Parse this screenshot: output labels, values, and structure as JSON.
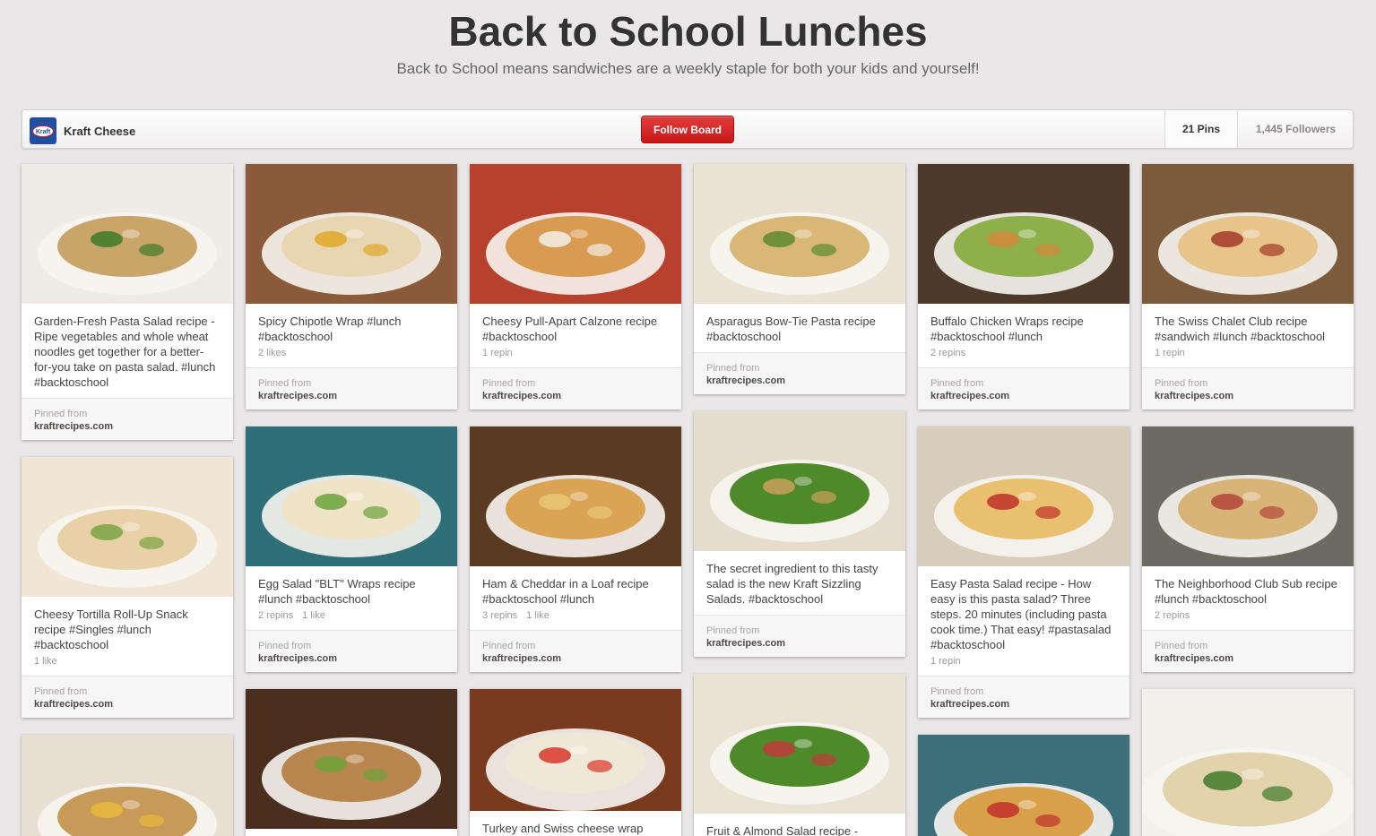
{
  "board": {
    "title": "Back to School Lunches",
    "description": "Back to School means sandwiches are a weekly staple for both your kids and yourself!",
    "owner": "Kraft Cheese",
    "owner_logo_text": "Kraft",
    "follow_label": "Follow Board",
    "pins_count": "21 Pins",
    "followers_count": "1,445 Followers"
  },
  "source_label": "Pinned from",
  "pins": [
    {
      "desc": "Garden-Fresh Pasta Salad recipe - Ripe vegetables and whole wheat noodles get together for a better-for-you take on pasta salad. #lunch #backtoschool",
      "stat1": "",
      "stat2": "",
      "source": "kraftrecipes.com",
      "img_base": "#efece5",
      "img_food": "#c9a56a",
      "img_accent": "#3e7a2a"
    },
    {
      "desc": "Spicy Chipotle Wrap #lunch #backtoschool",
      "stat1": "2 likes",
      "stat2": "",
      "source": "kraftrecipes.com",
      "img_base": "#8a5a3a",
      "img_food": "#e8d6b2",
      "img_accent": "#e0a827"
    },
    {
      "desc": "Cheesy Pull-Apart Calzone recipe #backtoschool",
      "stat1": "1 repin",
      "stat2": "",
      "source": "kraftrecipes.com",
      "img_base": "#b8412e",
      "img_food": "#d99a52",
      "img_accent": "#f3efe6"
    },
    {
      "desc": "Asparagus Bow-Tie Pasta recipe #backtoschool",
      "stat1": "",
      "stat2": "",
      "source": "kraftrecipes.com",
      "img_base": "#e9e3d6",
      "img_food": "#d8b777",
      "img_accent": "#5c8a2c"
    },
    {
      "desc": "Buffalo Chicken Wraps recipe #backtoschool #lunch",
      "stat1": "2 repins",
      "stat2": "",
      "source": "kraftrecipes.com",
      "img_base": "#4d3a2a",
      "img_food": "#8db04a",
      "img_accent": "#d58a3a"
    },
    {
      "desc": "The Swiss Chalet Club recipe #sandwich #lunch #backtoschool",
      "stat1": "1 repin",
      "stat2": "",
      "source": "kraftrecipes.com",
      "img_base": "#7c5a3c",
      "img_food": "#e7c48a",
      "img_accent": "#a33a2a"
    },
    {
      "desc": "Cheesy Tortilla Roll-Up Snack recipe #Singles #lunch #backtoschool",
      "stat1": "1 like",
      "stat2": "",
      "source": "kraftrecipes.com",
      "img_base": "#f0e6d3",
      "img_food": "#e8d1a6",
      "img_accent": "#7aa342"
    },
    {
      "desc": "Egg Salad \"BLT\" Wraps recipe #lunch #backtoschool",
      "stat1": "2 repins",
      "stat2": "1 like",
      "source": "kraftrecipes.com",
      "img_base": "#2e6f78",
      "img_food": "#efe3c6",
      "img_accent": "#6aa23a"
    },
    {
      "desc": "Ham & Cheddar in a Loaf recipe #backtoschool #lunch",
      "stat1": "3 repins",
      "stat2": "1 like",
      "source": "kraftrecipes.com",
      "img_base": "#5a3b22",
      "img_food": "#dba455",
      "img_accent": "#e8c873"
    },
    {
      "desc": "The secret ingredient to this tasty salad is the new Kraft Sizzling Salads. #backtoschool",
      "stat1": "",
      "stat2": "",
      "source": "kraftrecipes.com",
      "img_base": "#e4dccd",
      "img_food": "#4f8a2a",
      "img_accent": "#c9a05a"
    },
    {
      "desc": "Easy Pasta Salad recipe - How easy is this pasta salad? Three steps. 20 minutes (including pasta cook time.) That easy! #pastasalad #backtoschool",
      "stat1": "1 repin",
      "stat2": "",
      "source": "kraftrecipes.com",
      "img_base": "#d8cdbb",
      "img_food": "#e8c070",
      "img_accent": "#c0302a"
    },
    {
      "desc": "The Neighborhood Club Sub recipe #lunch #backtoschool",
      "stat1": "2 repins",
      "stat2": "",
      "source": "kraftrecipes.com",
      "img_base": "#6b6b62",
      "img_food": "#d8b478",
      "img_accent": "#b5473a"
    },
    {
      "desc": "",
      "stat1": "",
      "stat2": "",
      "source": "",
      "img_base": "#e7e0d2",
      "img_food": "#c89a5a",
      "img_accent": "#e8b83a"
    },
    {
      "desc": "",
      "stat1": "",
      "stat2": "",
      "source": "",
      "img_base": "#4a2f1e",
      "img_food": "#b8864e",
      "img_accent": "#6fa23a"
    },
    {
      "desc": "Turkey and Swiss cheese wrap",
      "stat1": "",
      "stat2": "",
      "source": "",
      "img_base": "#7a3a1e",
      "img_food": "#f0e8d6",
      "img_accent": "#d9362a"
    },
    {
      "desc": "Fruit & Almond Salad recipe -",
      "stat1": "",
      "stat2": "",
      "source": "",
      "img_base": "#e9e3d6",
      "img_food": "#4f8a2a",
      "img_accent": "#c03a3a"
    },
    {
      "desc": "",
      "stat1": "",
      "stat2": "",
      "source": "",
      "img_base": "#3d6f7a",
      "img_food": "#d9a04a",
      "img_accent": "#c0302a"
    },
    {
      "desc": "",
      "stat1": "",
      "stat2": "",
      "source": "",
      "img_base": "#f2f0ea",
      "img_food": "#e3d3ad",
      "img_accent": "#3f7a2a"
    }
  ]
}
